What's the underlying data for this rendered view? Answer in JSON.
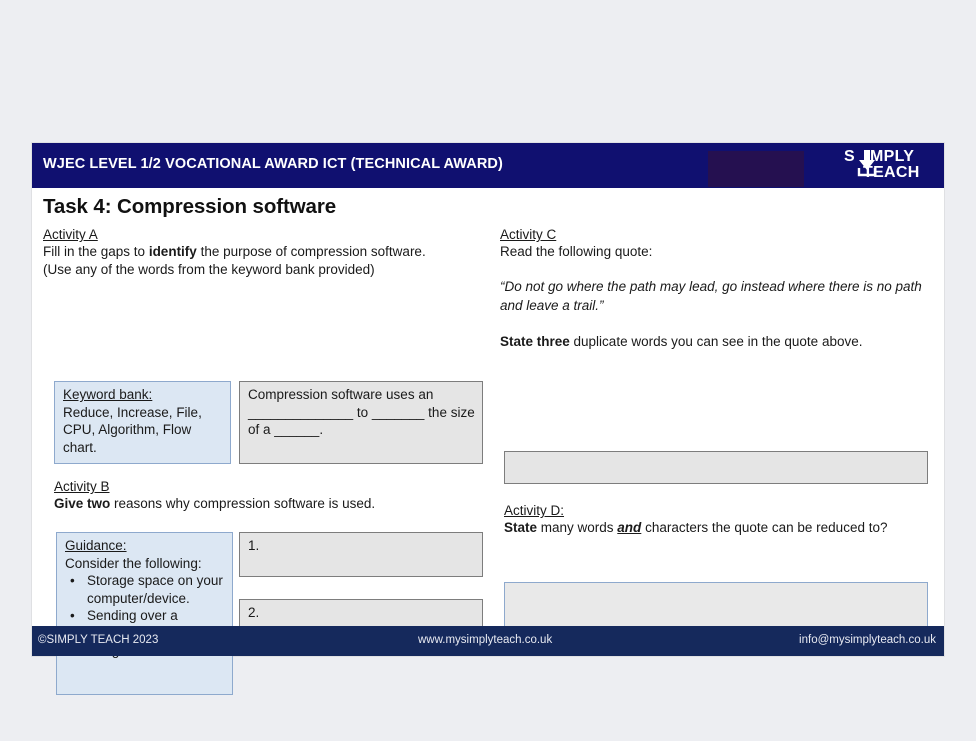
{
  "header": {
    "title": "WJEC LEVEL 1/2 VOCATIONAL AWARD ICT (TECHNICAL AWARD)",
    "logo_line1_pre": "S",
    "logo_line1_post": "MPLY",
    "logo_line2": "TEACH",
    "logo_icon": "download-arrow-icon",
    "placeholder_color": "#251050",
    "bar_color": "#101070"
  },
  "page_title": "Task 4: Compression software",
  "activity_a": {
    "heading": "Activity A",
    "line1_pre": "Fill in the gaps to ",
    "line1_bold": "identify",
    "line1_post": " the purpose of compression software.",
    "line2": "(Use any of the words from the keyword bank provided)",
    "keyword_bank": {
      "heading": "Keyword bank:",
      "words": "Reduce, Increase, File, CPU, Algorithm, Flow chart."
    },
    "gapfill": "Compression software uses an ______________ to _______ the size of a ______."
  },
  "activity_b": {
    "heading": "Activity B",
    "prompt_bold": "Give two",
    "prompt_rest": " reasons why compression software is used.",
    "guidance": {
      "heading": "Guidance:",
      "intro": "Consider the following:",
      "bullets": [
        "Storage space on your computer/device.",
        "Sending over a network via email or using the cloud."
      ]
    },
    "answers": [
      {
        "label": "1."
      },
      {
        "label": "2."
      }
    ]
  },
  "activity_c": {
    "heading": "Activity C",
    "instruction": "Read the following quote:",
    "quote": "“Do not go where the path may lead, go instead where there is no path and leave a trail.”",
    "task_bold": "State three",
    "task_rest": " duplicate words you can see in the quote above.",
    "answer": ""
  },
  "activity_d": {
    "heading": "Activity D:",
    "task_bold": "State",
    "task_mid1": " many words ",
    "task_emph": "and",
    "task_mid2": " characters the quote can be reduced to?",
    "answer": ""
  },
  "footer": {
    "copyright": "©SIMPLY TEACH 2023",
    "website": "www.mysimplyteach.co.uk",
    "email": "info@mysimplyteach.co.uk",
    "bar_color": "#15295c"
  }
}
